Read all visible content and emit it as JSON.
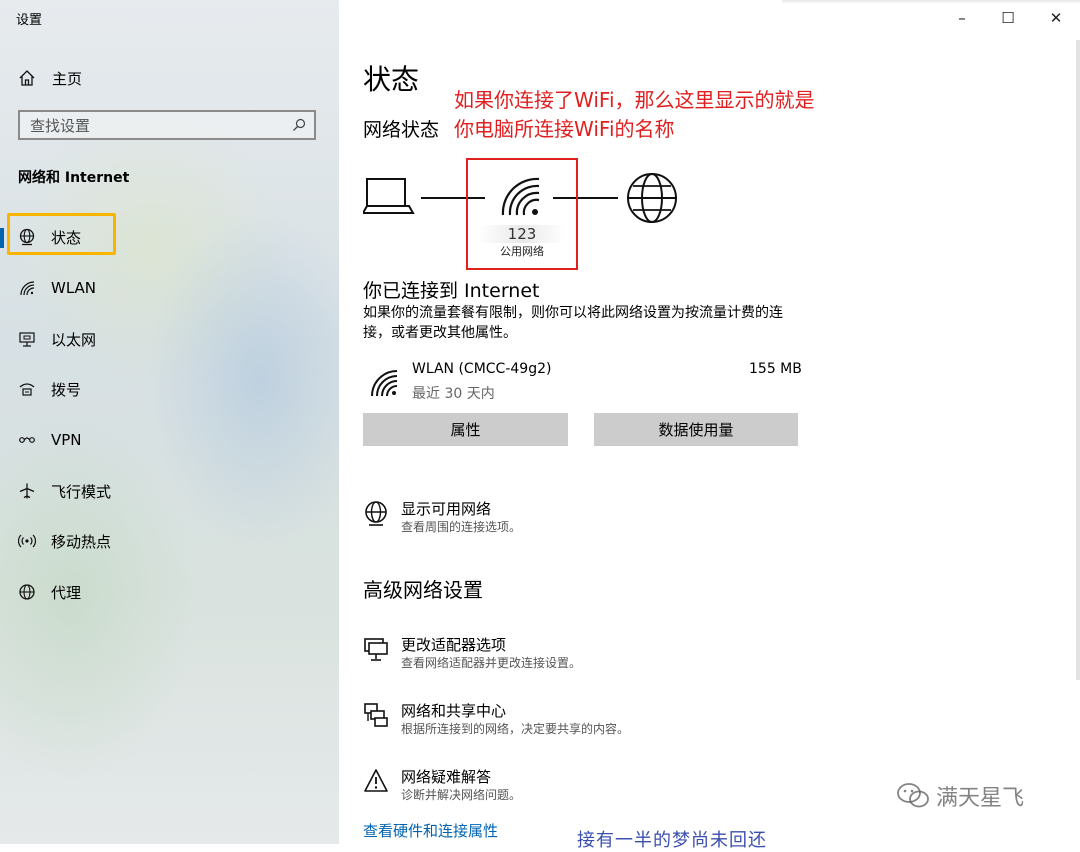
{
  "app_title": "设置",
  "sidebar": {
    "home_label": "主页",
    "search_placeholder": "查找设置",
    "section_title": "网络和 Internet",
    "items": [
      {
        "label": "状态",
        "icon": "status-globe-icon"
      },
      {
        "label": "WLAN",
        "icon": "wifi-icon"
      },
      {
        "label": "以太网",
        "icon": "ethernet-icon"
      },
      {
        "label": "拨号",
        "icon": "dialup-icon"
      },
      {
        "label": "VPN",
        "icon": "vpn-icon"
      },
      {
        "label": "飞行模式",
        "icon": "airplane-icon"
      },
      {
        "label": "移动热点",
        "icon": "hotspot-icon"
      },
      {
        "label": "代理",
        "icon": "globe-icon"
      }
    ]
  },
  "window_controls": {
    "minimize": "–",
    "maximize": "☐",
    "close": "✕"
  },
  "main": {
    "title": "状态",
    "network_status_label": "网络状态",
    "annotation": "如果你连接了WiFi，那么这里显示的就是你电脑所连接WiFi的名称",
    "network_name": "123",
    "network_type": "公用网络",
    "connected_title": "你已连接到 Internet",
    "description": "如果你的流量套餐有限制，则你可以将此网络设置为按流量计费的连接，或者更改其他属性。",
    "wlan": {
      "name": "WLAN (CMCC-49g2)",
      "time": "最近 30 天内",
      "usage": "155 MB"
    },
    "buttons": {
      "properties": "属性",
      "data_usage": "数据使用量"
    },
    "show_networks": {
      "title": "显示可用网络",
      "subtitle": "查看周围的连接选项。"
    },
    "advanced_title": "高级网络设置",
    "advanced_items": [
      {
        "title": "更改适配器选项",
        "subtitle": "查看网络适配器并更改连接设置。"
      },
      {
        "title": "网络和共享中心",
        "subtitle": "根据所连接到的网络，决定要共享的内容。"
      },
      {
        "title": "网络疑难解答",
        "subtitle": "诊断并解决网络问题。"
      }
    ],
    "hardware_link": "查看硬件和连接属性",
    "watermark": "满天星飞",
    "partial_text": "接有一半的梦尚未回还"
  },
  "colors": {
    "accent": "#0063b1",
    "annotation_red": "#e02020",
    "highlight_yellow": "#f7b500",
    "button_gray": "#cccccc"
  }
}
